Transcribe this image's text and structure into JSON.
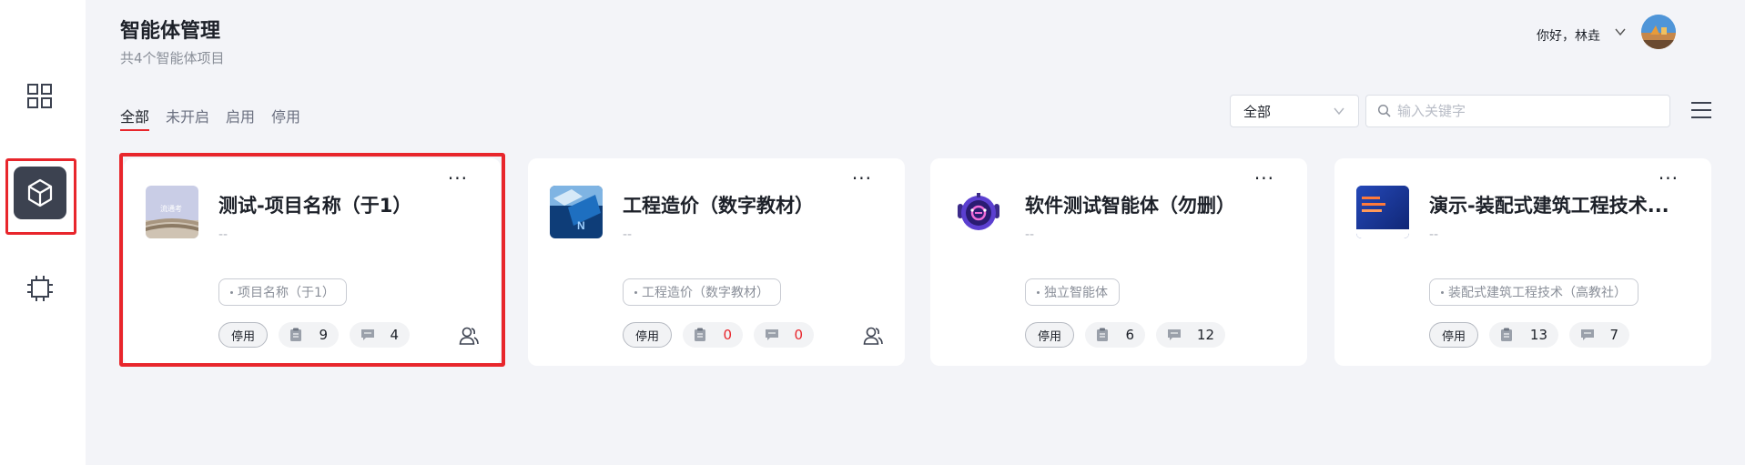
{
  "header": {
    "title": "智能体管理",
    "subtitle": "共4个智能体项目"
  },
  "user": {
    "greeting": "你好，林垚",
    "icons": [
      "chevron-down-icon",
      "avatar"
    ]
  },
  "tabs": [
    {
      "label": "全部",
      "active": true
    },
    {
      "label": "未开启",
      "active": false
    },
    {
      "label": "启用",
      "active": false
    },
    {
      "label": "停用",
      "active": false
    }
  ],
  "filter": {
    "select_value": "全部",
    "search_placeholder": "输入关键字"
  },
  "sidebar": {
    "items": [
      {
        "icon": "grid-icon",
        "active": false
      },
      {
        "icon": "cube-icon",
        "active": true
      },
      {
        "icon": "crop-icon",
        "active": false
      }
    ]
  },
  "cards": [
    {
      "title": "测试-项目名称（于1）",
      "desc": "--",
      "tag": "项目名称（于1）",
      "status": "停用",
      "docs": "9",
      "messages": "4",
      "docs_zero": false,
      "messages_zero": false,
      "thumb_text": "流通考",
      "has_users_icon": true
    },
    {
      "title": "工程造价（数字教材）",
      "desc": "--",
      "tag": "工程造价（数字教材）",
      "status": "停用",
      "docs": "0",
      "messages": "0",
      "docs_zero": true,
      "messages_zero": true,
      "has_users_icon": true
    },
    {
      "title": "软件测试智能体（勿删）",
      "desc": "--",
      "tag": "独立智能体",
      "status": "停用",
      "docs": "6",
      "messages": "12",
      "docs_zero": false,
      "messages_zero": false,
      "has_users_icon": false
    },
    {
      "title": "演示-装配式建筑工程技术...",
      "desc": "--",
      "tag": "装配式建筑工程技术（高教社）",
      "status": "停用",
      "docs": "13",
      "messages": "7",
      "docs_zero": false,
      "messages_zero": false,
      "has_users_icon": false
    }
  ],
  "colors": {
    "accent_red": "#e8262c",
    "background": "#f3f4f8",
    "sidebar_active": "#3c4250"
  }
}
